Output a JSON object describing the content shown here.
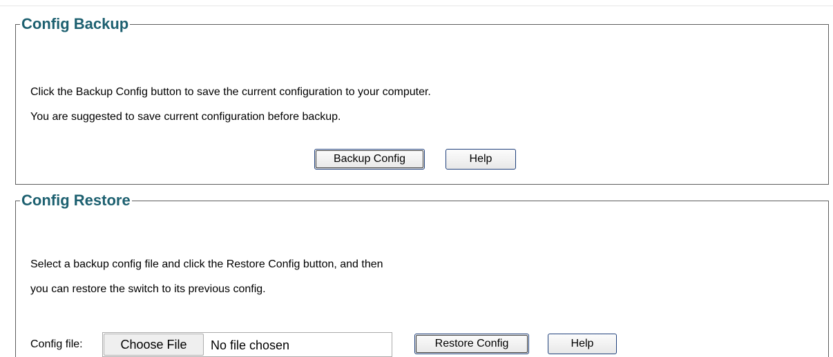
{
  "backup": {
    "title": "Config Backup",
    "line1": "Click the Backup Config button to save the current configuration to your computer.",
    "line2": "You are suggested to save current configuration before backup.",
    "backup_button": "Backup Config",
    "help_button": "Help"
  },
  "restore": {
    "title": "Config Restore",
    "line1": "Select a backup config file and click the Restore Config button, and then",
    "line2": "you can restore the switch to its previous config.",
    "file_label": "Config file:",
    "choose_file_button": "Choose File",
    "file_status": "No file chosen",
    "restore_button": "Restore Config",
    "help_button": "Help"
  },
  "colors": {
    "title": "#1d6070",
    "border": "#5c5c5c",
    "button_border": "#1e3f7a"
  }
}
